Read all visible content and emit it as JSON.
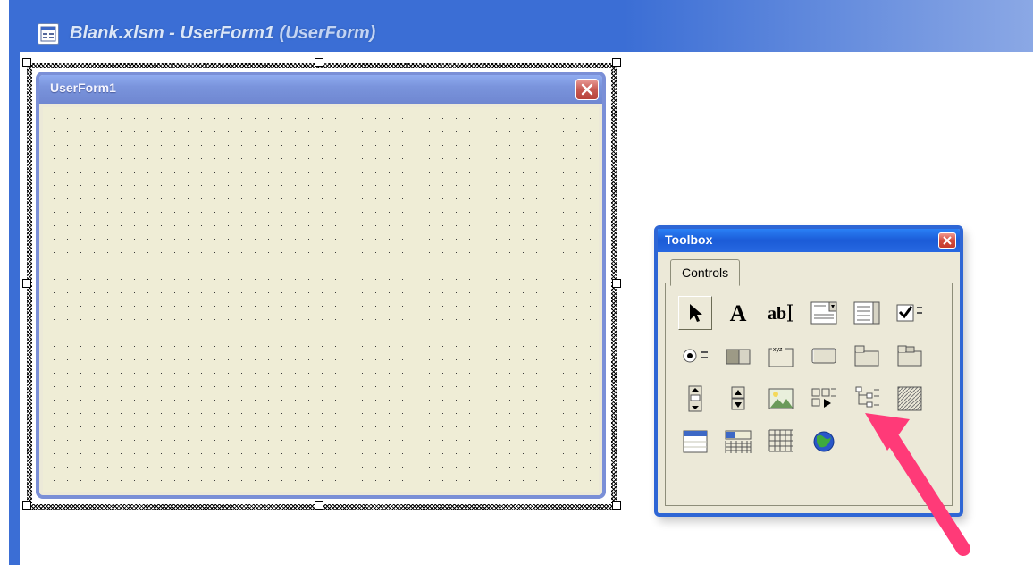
{
  "designer": {
    "window_title_prefix": "Blank.xlsm - ",
    "window_title_form": "UserForm1 ",
    "window_title_suffix": "(UserForm)"
  },
  "userform": {
    "caption": "UserForm1"
  },
  "toolbox": {
    "title": "Toolbox",
    "tab_label": "Controls",
    "tools": [
      {
        "id": "select-objects",
        "row": 0
      },
      {
        "id": "label",
        "row": 0
      },
      {
        "id": "textbox",
        "row": 0
      },
      {
        "id": "combobox",
        "row": 0
      },
      {
        "id": "listbox",
        "row": 0
      },
      {
        "id": "checkbox",
        "row": 0
      },
      {
        "id": "optionbutton",
        "row": 1
      },
      {
        "id": "togglebutton",
        "row": 1
      },
      {
        "id": "frame",
        "row": 1
      },
      {
        "id": "commandbutton",
        "row": 1
      },
      {
        "id": "tabstrip",
        "row": 1
      },
      {
        "id": "multipage",
        "row": 1
      },
      {
        "id": "scrollbar",
        "row": 2
      },
      {
        "id": "spinbutton",
        "row": 2
      },
      {
        "id": "image",
        "row": 2
      },
      {
        "id": "refedit",
        "row": 2
      },
      {
        "id": "treeview",
        "row": 2
      },
      {
        "id": "imagelist",
        "row": 2
      },
      {
        "id": "listview",
        "row": 3
      },
      {
        "id": "progressbar",
        "row": 3
      },
      {
        "id": "datepicker",
        "row": 3
      },
      {
        "id": "webbrowser",
        "row": 3
      }
    ]
  }
}
